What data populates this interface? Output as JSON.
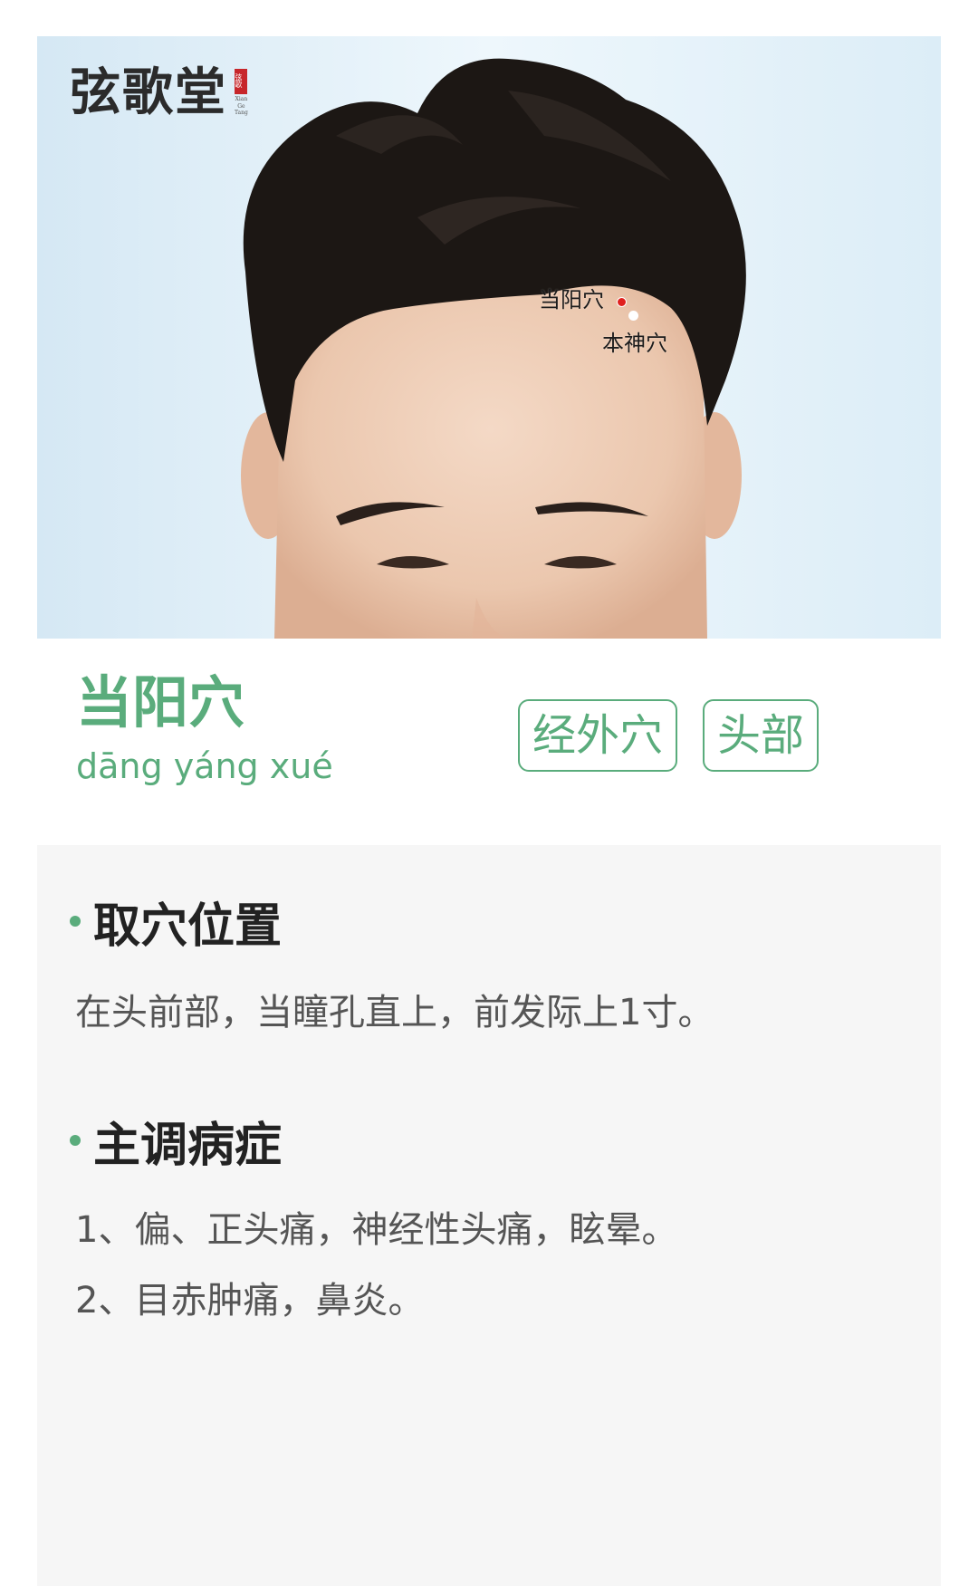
{
  "brand": {
    "logo_text": "弦歌堂",
    "seal_text": "弦歌",
    "english_lines": [
      "Xian",
      "Ge",
      "Tang"
    ]
  },
  "image": {
    "points": [
      {
        "label": "当阳穴",
        "dot_color": "#e0201e"
      },
      {
        "label": "本神穴",
        "dot_color": "#ffffff"
      }
    ]
  },
  "acupoint": {
    "name": "当阳穴",
    "pinyin": "dāng yáng xué",
    "tags": [
      "经外穴",
      "头部"
    ]
  },
  "sections": {
    "location": {
      "title": "取穴位置",
      "lines": [
        "在头前部，当瞳孔直上，前发际上1寸。"
      ]
    },
    "indications": {
      "title": "主调病症",
      "lines": [
        "1、偏、正头痛，神经性头痛，眩晕。",
        "2、目赤肿痛，鼻炎。"
      ]
    }
  },
  "colors": {
    "accent": "#5aac7c",
    "heading": "#222222",
    "body_text": "#555555",
    "panel_bg": "#f6f6f6"
  }
}
